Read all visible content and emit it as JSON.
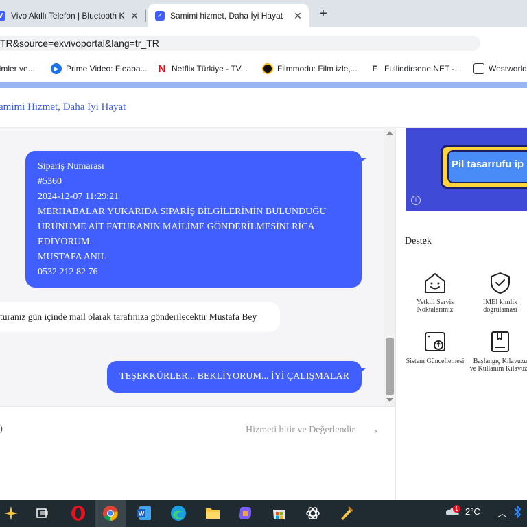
{
  "browser": {
    "tabs": [
      {
        "title": "Vivo Akıllı Telefon | Bluetooth K",
        "close": "✕"
      },
      {
        "title": "Samimi hizmet, Daha İyi Hayat",
        "close": "✕"
      }
    ],
    "new_tab": "+",
    "url": "TR&source=exvivoportal&lang=tr_TR",
    "bookmarks": [
      {
        "label": "ilmler ve..."
      },
      {
        "label": "Prime Video: Fleaba..."
      },
      {
        "label": "Netflix Türkiye - TV..."
      },
      {
        "label": "Filmmodu: Film izle,..."
      },
      {
        "label": "Fullindirsene.NET -..."
      },
      {
        "label": "Westworld"
      }
    ]
  },
  "page": {
    "title": "amimi Hizmet, Daha İyi Hayat"
  },
  "chat": {
    "messages": [
      {
        "sender": "user",
        "lines": [
          "Sipariş Numarası",
          "#5360",
          "2024-12-07 11:29:21",
          "MERHABALAR YUKARIDA SİPARİŞ BİLGİLERİMİN BULUNDUĞU",
          "ÜRÜNÜME AİT FATURANIN MAİLİME GÖNDERİLMESİNİ RİCA",
          "EDİYORUM.",
          "MUSTAFA ANIL",
          "0532 212 82 76"
        ]
      },
      {
        "sender": "agent",
        "text": "turanız gün içinde mail olarak tarafınıza gönderilecektir Mustafa Bey"
      },
      {
        "sender": "user",
        "text": "TEŞEKKÜRLER... BEKLİYORUM... İYİ ÇALIŞMALAR"
      }
    ],
    "end_service": "Hizmeti bitir ve Değerlendir"
  },
  "sidebar": {
    "banner_text": "Pil tasarrufu ip",
    "support_title": "Destek",
    "tiles": [
      {
        "label_line1": "Yetkili Servis",
        "label_line2": "Noktalarımız",
        "icon": "house-smile-icon"
      },
      {
        "label_line1": "IMEI kimlik",
        "label_line2": "doğrulaması",
        "icon": "shield-check-icon"
      },
      {
        "label_line1": "Sistem Güncellemesi",
        "label_line2": "",
        "icon": "system-update-icon"
      },
      {
        "label_line1": "Başlangıç Kılavuzu",
        "label_line2": "ve Kullanım Kılavuzu",
        "icon": "manual-book-icon"
      }
    ]
  },
  "taskbar": {
    "weather": "2°C",
    "notification_count": "1"
  },
  "colors": {
    "accent": "#415fff",
    "title_blue": "#3b5ce6",
    "chat_bg": "#f5f5f7",
    "taskbar": "#1f2a31"
  }
}
